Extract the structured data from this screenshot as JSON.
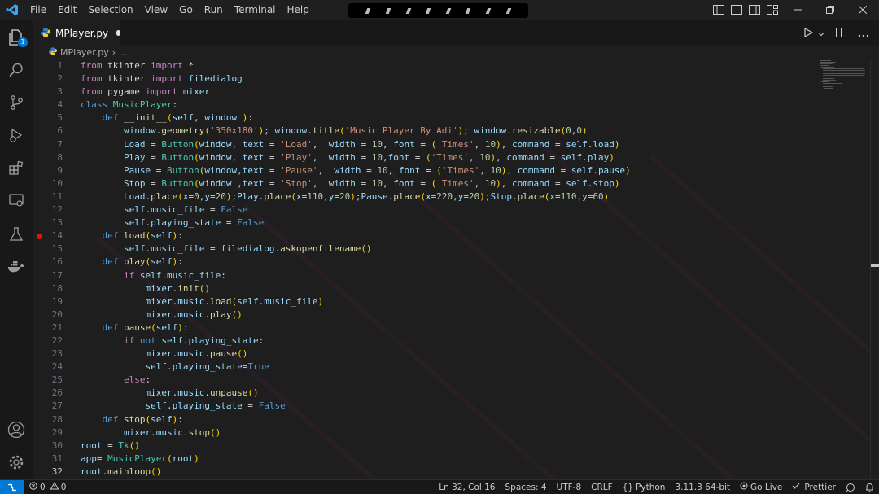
{
  "menu": [
    "File",
    "Edit",
    "Selection",
    "View",
    "Go",
    "Run",
    "Terminal",
    "Help"
  ],
  "tab": {
    "filename": "MPlayer.py"
  },
  "breadcrumb": {
    "file": "MPlayer.py",
    "more": "..."
  },
  "activity": {
    "explorer_badge": "1"
  },
  "editor": {
    "active_line": 32,
    "breakpoint_line": 14,
    "line_numbers": [
      "1",
      "2",
      "3",
      "4",
      "5",
      "6",
      "7",
      "8",
      "9",
      "10",
      "11",
      "12",
      "13",
      "14",
      "15",
      "16",
      "17",
      "18",
      "19",
      "20",
      "21",
      "22",
      "23",
      "24",
      "25",
      "26",
      "27",
      "28",
      "29",
      "30",
      "31",
      "32"
    ],
    "code_lines": [
      "from tkinter import *",
      "from tkinter import filedialog",
      "from pygame import mixer",
      "class MusicPlayer:",
      "    def __init__(self, window ):",
      "        window.geometry('350x180'); window.title('Music Player By Adi'); window.resizable(0,0)",
      "        Load = Button(window, text = 'Load',  width = 10, font = ('Times', 10), command = self.load)",
      "        Play = Button(window, text = 'Play',  width = 10,font = ('Times', 10), command = self.play)",
      "        Pause = Button(window,text = 'Pause',  width = 10, font = ('Times', 10), command = self.pause)",
      "        Stop = Button(window ,text = 'Stop',  width = 10, font = ('Times', 10), command = self.stop)",
      "        Load.place(x=0,y=20);Play.place(x=110,y=20);Pause.place(x=220,y=20);Stop.place(x=110,y=60)",
      "        self.music_file = False",
      "        self.playing_state = False",
      "    def load(self):",
      "        self.music_file = filedialog.askopenfilename()",
      "    def play(self):",
      "        if self.music_file:",
      "            mixer.init()",
      "            mixer.music.load(self.music_file)",
      "            mixer.music.play()",
      "    def pause(self):",
      "        if not self.playing_state:",
      "            mixer.music.pause()",
      "            self.playing_state=True",
      "        else:",
      "            mixer.music.unpause()",
      "            self.playing_state = False",
      "    def stop(self):",
      "        mixer.music.stop()",
      "root = Tk()",
      "app= MusicPlayer(root)",
      "root.mainloop()"
    ]
  },
  "status": {
    "errors": "0",
    "warnings": "0",
    "position": "Ln 32, Col 16",
    "spaces": "Spaces: 4",
    "encoding": "UTF-8",
    "eol": "CRLF",
    "language": "Python",
    "interpreter": "3.11.3 64-bit",
    "golive": "Go Live",
    "prettier": "Prettier"
  },
  "colors": {
    "accent": "#0078d4",
    "keyword": "#c586c0",
    "storage": "#569cd6",
    "class": "#4ec9b0",
    "function": "#dcdcaa",
    "variable": "#9cdcfe",
    "string": "#ce9178",
    "number": "#b5cea8",
    "breakpoint": "#e51400"
  },
  "icons": [
    "vscode-logo",
    "explorer-icon",
    "search-icon",
    "source-control-icon",
    "run-debug-icon",
    "extensions-icon",
    "remote-explorer-icon",
    "testing-icon",
    "docker-icon",
    "account-icon",
    "manage-gear-icon",
    "python-file-icon",
    "run-icon",
    "split-editor-icon",
    "more-icon"
  ]
}
